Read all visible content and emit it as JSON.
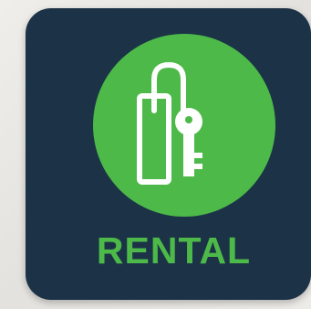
{
  "badge": {
    "label": "RENTAL",
    "icon": "key-tag-icon"
  },
  "colors": {
    "card_background": "#1c3247",
    "accent_green": "#4cb948",
    "icon_stroke": "#ffffff",
    "label_color": "#4cb948"
  }
}
